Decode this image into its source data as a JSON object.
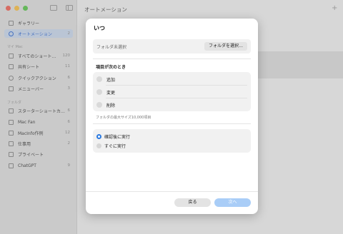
{
  "sidebar": {
    "section_library": [
      {
        "label": "ギャラリー",
        "count": "",
        "icon": "grid-icon"
      },
      {
        "label": "オートメーション",
        "count": "2",
        "icon": "clock-icon",
        "selected": true
      }
    ],
    "section_mac_title": "マイ Mac",
    "section_mac": [
      {
        "label": "すべてのショート…",
        "count": "120",
        "icon": "stack-icon"
      },
      {
        "label": "共有シート",
        "count": "11",
        "icon": "share-icon"
      },
      {
        "label": "クイックアクション",
        "count": "6",
        "icon": "gear-icon"
      },
      {
        "label": "メニューバー",
        "count": "3",
        "icon": "menubar-icon"
      }
    ],
    "section_folders_title": "フォルダ",
    "section_folders": [
      {
        "label": "スターターショートカ…",
        "count": "6",
        "icon": "folder-icon"
      },
      {
        "label": "Mac Fan",
        "count": "6",
        "icon": "folder-icon"
      },
      {
        "label": "MacInfo作例",
        "count": "12",
        "icon": "folder-icon"
      },
      {
        "label": "仕事用",
        "count": "2",
        "icon": "folder-icon"
      },
      {
        "label": "プライベート",
        "count": "",
        "icon": "house-icon"
      },
      {
        "label": "ChatGPT",
        "count": "9",
        "icon": "folder-icon"
      }
    ]
  },
  "main": {
    "title": "オートメーション",
    "add_symbol": "+"
  },
  "dialog": {
    "title": "いつ",
    "folder_label": "フォルダ未選択",
    "folder_button": "フォルダを選択…",
    "when_title": "項目が次のとき",
    "checks": [
      "追加",
      "変更",
      "削除"
    ],
    "max_size": "フォルダの最大サイズ10,000項目",
    "radios": [
      {
        "label": "確認後に実行",
        "selected": true
      },
      {
        "label": "すぐに実行",
        "selected": false
      }
    ],
    "back_button": "戻る",
    "next_button": "次へ"
  },
  "colors": {
    "accent": "#2a7ae2",
    "next_disabled": "#a9cdf7",
    "selected_sidebar": "#c9d6ea"
  }
}
